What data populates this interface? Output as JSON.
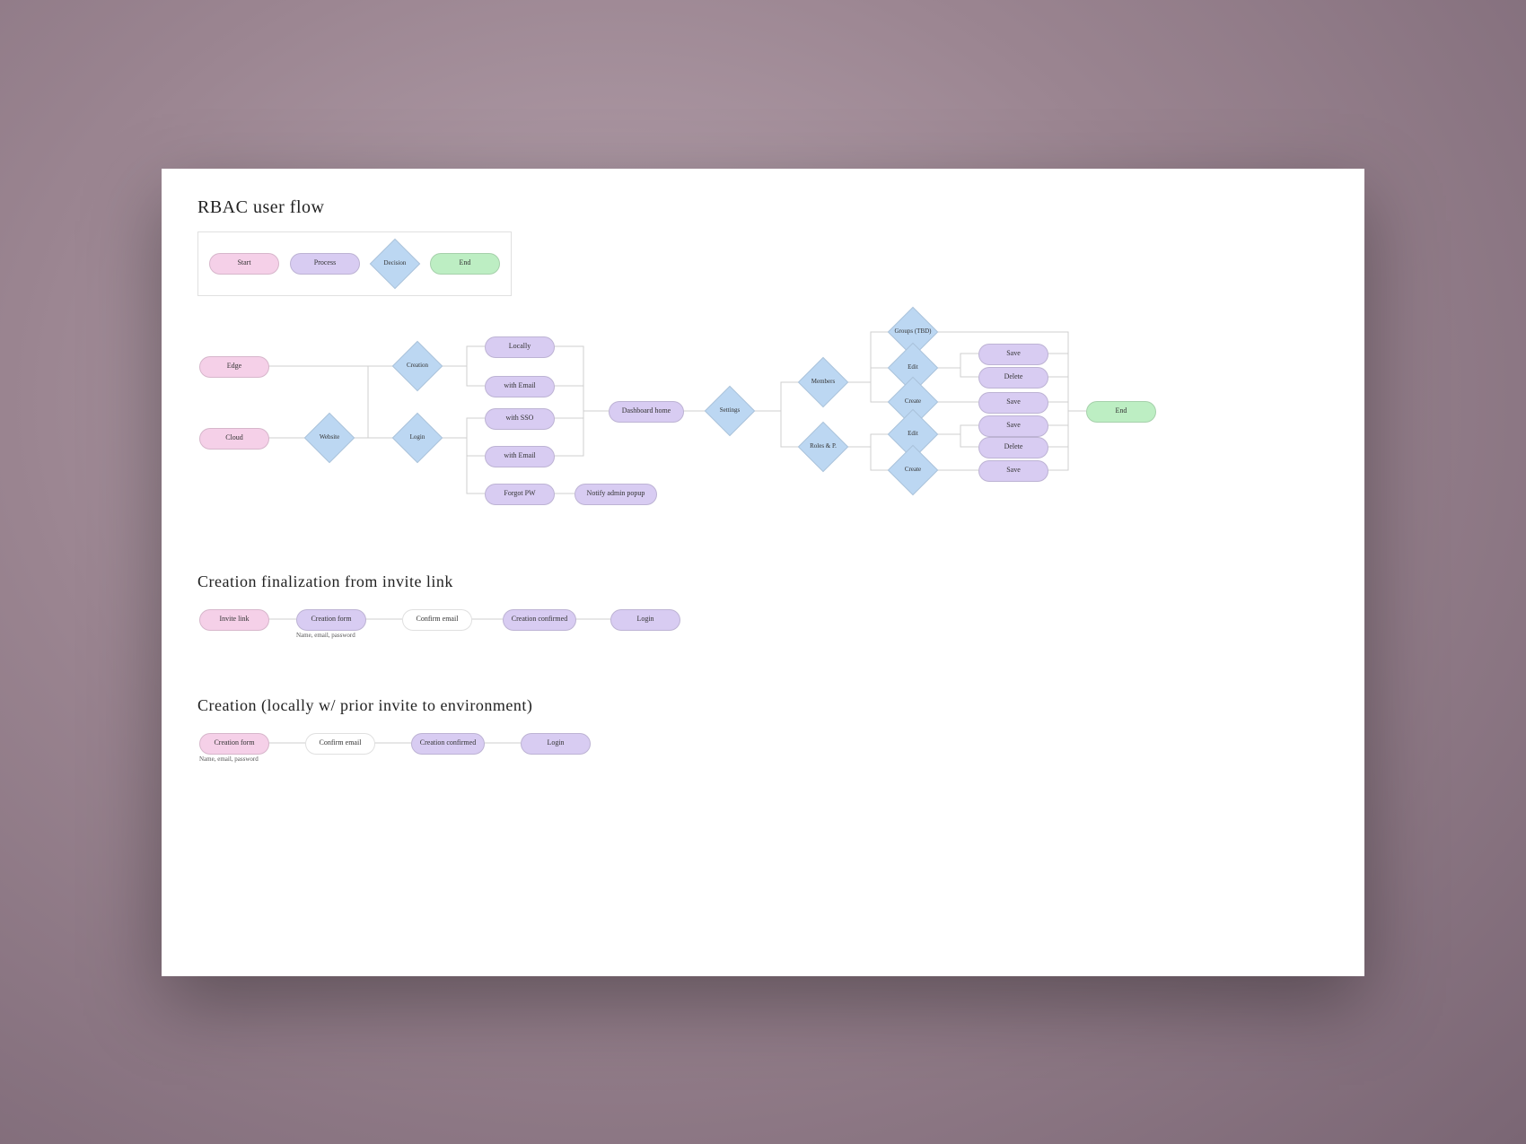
{
  "titles": {
    "main": "RBAC user flow",
    "section2": "Creation finalization from invite link",
    "section3": "Creation (locally w/ prior invite to environment)"
  },
  "legend": {
    "start": "Start",
    "process": "Process",
    "decision": "Decision",
    "end": "End"
  },
  "flow": {
    "edge": "Edge",
    "cloud": "Cloud",
    "website": "Website",
    "creation": "Creation",
    "login": "Login",
    "locally": "Locally",
    "with_email": "with Email",
    "with_sso": "with SSO",
    "with_email2": "with Email",
    "forgot_pw": "Forgot PW",
    "notify_admin": "Notify admin popup",
    "dashboard": "Dashboard home",
    "settings": "Settings",
    "members": "Members",
    "roles": "Roles & P.",
    "groups": "Groups (TBD)",
    "edit": "Edit",
    "create": "Create",
    "edit2": "Edit",
    "create2": "Create",
    "save": "Save",
    "delete": "Delete",
    "save2": "Save",
    "save3": "Save",
    "delete2": "Delete",
    "save4": "Save",
    "end": "End"
  },
  "section2": {
    "invite_link": "Invite link",
    "creation_form": "Creation form",
    "creation_form_sub": "Name, email, password",
    "confirm_email": "Confirm email",
    "creation_confirmed": "Creation confirmed",
    "login": "Login"
  },
  "section3": {
    "creation_form": "Creation form",
    "creation_form_sub": "Name, email, password",
    "confirm_email": "Confirm email",
    "creation_confirmed": "Creation confirmed",
    "login": "Login"
  }
}
